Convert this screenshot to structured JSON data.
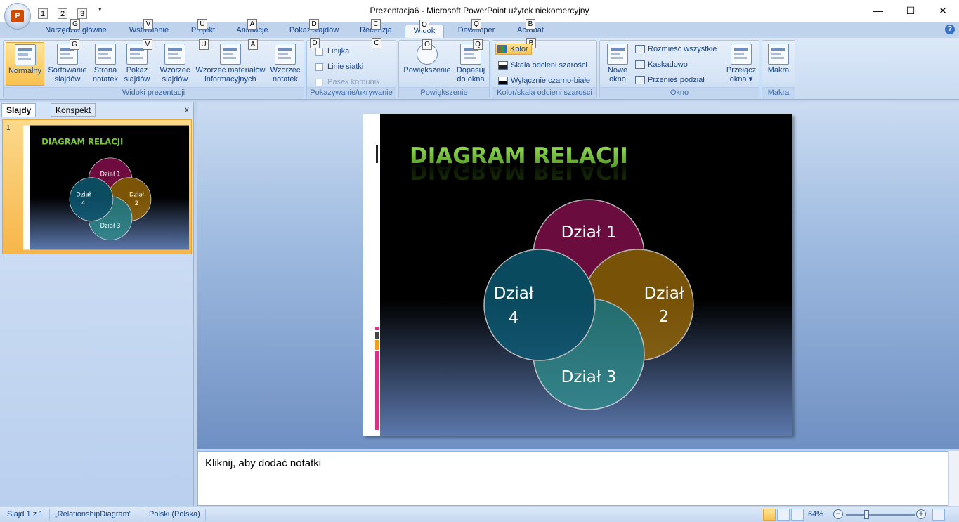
{
  "window": {
    "title": "Prezentacja6 - Microsoft PowerPoint użytek niekomercyjny",
    "minimize": "—",
    "maximize": "☐",
    "close": "✕",
    "qat_keys": [
      "1",
      "2",
      "3"
    ]
  },
  "tabs": [
    {
      "label": "Narzędzia główne",
      "key": "G"
    },
    {
      "label": "Wstawianie",
      "key": "V"
    },
    {
      "label": "Projekt",
      "key": "U"
    },
    {
      "label": "Animacje",
      "key": "A"
    },
    {
      "label": "Pokaz slajdów",
      "key": "D"
    },
    {
      "label": "Recenzja",
      "key": "C"
    },
    {
      "label": "Widok",
      "key": "O"
    },
    {
      "label": "Deweloper",
      "key": "Q"
    },
    {
      "label": "Acrobat",
      "key": "B"
    }
  ],
  "help": "?",
  "ribbon": {
    "views": {
      "label": "Widoki prezentacji",
      "normal": "Normalny",
      "sorter": [
        "Sortowanie",
        "slajdów"
      ],
      "notes_page": [
        "Strona",
        "notatek"
      ],
      "slideshow": [
        "Pokaz",
        "slajdów"
      ],
      "slide_master": [
        "Wzorzec",
        "slajdów"
      ],
      "handout_master": [
        "Wzorzec materiałów",
        "informacyjnych"
      ],
      "notes_master": [
        "Wzorzec",
        "notatek"
      ]
    },
    "showhide": {
      "label": "Pokazywanie/ukrywanie",
      "ruler": "Linijka",
      "gridlines": "Linie siatki",
      "msgbar": "Pasek komunik."
    },
    "zoom": {
      "label": "Powiększenie",
      "zoom": "Powiększenie",
      "fit": [
        "Dopasuj",
        "do okna"
      ]
    },
    "color": {
      "label": "Kolor/skala odcieni szarości",
      "color": "Kolor",
      "grayscale": "Skala odcieni szarości",
      "bw": "Wyłącznie czarno-białe"
    },
    "window": {
      "label": "Okno",
      "new_window": [
        "Nowe",
        "okno"
      ],
      "arrange_all": "Rozmieść wszystkie",
      "cascade": "Kaskadowo",
      "move_split": "Przenieś podział",
      "switch": [
        "Przełącz",
        "okna ▾"
      ]
    },
    "macros": {
      "label": "Makra",
      "macros": "Makra"
    }
  },
  "panel": {
    "tab_slides": "Slajdy",
    "tab_outline": "Konspekt",
    "close": "x",
    "slide_number": "1"
  },
  "slide": {
    "title": "DIAGRAM RELACJI",
    "circles": [
      {
        "label": [
          "Dział 1"
        ],
        "color": "#8a1050"
      },
      {
        "label": [
          "Dział",
          "2"
        ],
        "color": "#9a6a08"
      },
      {
        "label": [
          "Dział 3"
        ],
        "color": "#2f8c8c"
      },
      {
        "label": [
          "Dział",
          "4"
        ],
        "color": "#0e5f7a"
      }
    ]
  },
  "notes": {
    "placeholder": "Kliknij, aby dodać notatki"
  },
  "status": {
    "slide": "Slajd 1 z 1",
    "theme": "„RelationshipDiagram”",
    "language": "Polski (Polska)",
    "zoom": "64%",
    "zoom_minus": "−",
    "zoom_plus": "+"
  }
}
